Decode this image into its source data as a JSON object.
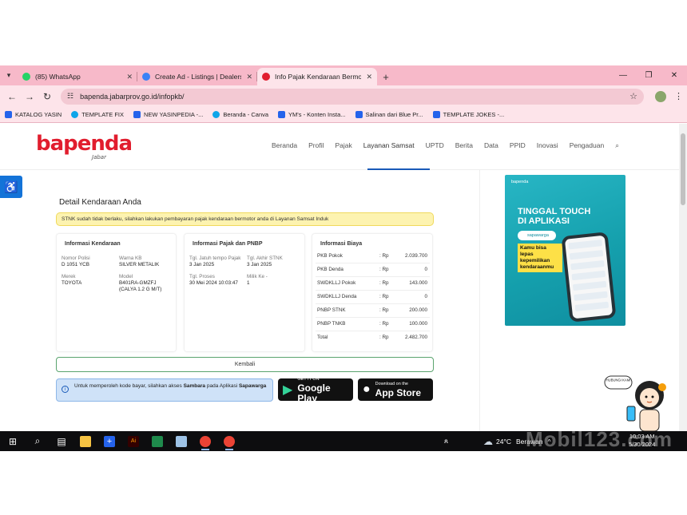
{
  "browser": {
    "tabs": [
      {
        "label": "(85) WhatsApp",
        "icon": "whatsapp-icon",
        "color": "#25d366"
      },
      {
        "label": "Create Ad - Listings | Dealership",
        "icon": "globe-icon",
        "color": "#3b82f6"
      },
      {
        "label": "Info Pajak Kendaraan Bermotor",
        "icon": "bapenda-icon",
        "color": "#e11d2e"
      }
    ],
    "url": "bapenda.jabarprov.go.id/infopkb/",
    "bookmarks": [
      {
        "label": "KATALOG YASIN",
        "color": "#2563eb"
      },
      {
        "label": "TEMPLATE FIX",
        "color": "#0ea5e9"
      },
      {
        "label": "NEW YASINPEDIA -...",
        "color": "#2563eb"
      },
      {
        "label": "Beranda - Canva",
        "color": "#0ea5e9"
      },
      {
        "label": "YM's - Konten Insta...",
        "color": "#2563eb"
      },
      {
        "label": "Salinan dari Blue Pr...",
        "color": "#2563eb"
      },
      {
        "label": "TEMPLATE JOKES -...",
        "color": "#2563eb"
      }
    ]
  },
  "site": {
    "logo": "bapenda",
    "logo_sub": "Jabar",
    "nav": [
      "Beranda",
      "Profil",
      "Pajak",
      "Layanan Samsat",
      "UPTD",
      "Berita",
      "Data",
      "PPID",
      "Inovasi",
      "Pengaduan"
    ],
    "active_nav": "Layanan Samsat"
  },
  "main": {
    "title": "Detail Kendaraan Anda",
    "alert": "STNK sudah tidak berlaku, silahkan lakukan pembayaran pajak kendaraan bermotor anda di Layanan Samsat Induk",
    "vehicle": {
      "heading": "Informasi Kendaraan",
      "nomor_polisi_label": "Nomor Polisi",
      "nomor_polisi": "D 1051 YCB",
      "warna_label": "Warna KB",
      "warna": "SILVER METALIK",
      "merek_label": "Merek",
      "merek": "TOYOTA",
      "model_label": "Model",
      "model_line1": "B401RA-GMZFJ",
      "model_line2": "(CALYA 1.2 G M/T)"
    },
    "tax": {
      "heading": "Informasi Pajak dan PNBP",
      "jatuh_tempo_label": "Tgl. Jatuh tempo Pajak",
      "jatuh_tempo": "3 Jan 2025",
      "akhir_stnk_label": "Tgl. Akhir STNK",
      "akhir_stnk": "3 Jan 2025",
      "proses_label": "Tgl. Proses",
      "proses": "30 Mei 2024 10:03:47",
      "milik_label": "Milik Ke -",
      "milik": "1"
    },
    "fees": {
      "heading": "Informasi Biaya",
      "currency": ": Rp",
      "rows": [
        {
          "label": "PKB Pokok",
          "value": "2.039.700"
        },
        {
          "label": "PKB Denda",
          "value": "0"
        },
        {
          "label": "SWDKLLJ Pokok",
          "value": "143.000"
        },
        {
          "label": "SWDKLLJ Denda",
          "value": "0"
        },
        {
          "label": "PNBP STNK",
          "value": "200.000"
        },
        {
          "label": "PNBP TNKB",
          "value": "100.000"
        },
        {
          "label": "Total",
          "value": "2.482.700"
        }
      ]
    },
    "back_button": "Kembali",
    "info_pre": "Untuk memperoleh kode bayar, silahkan akses ",
    "info_bold1": "Sambara",
    "info_mid": " pada Aplikasi ",
    "info_bold2": "Sapawarga",
    "google_play_small": "GET IT ON",
    "google_play": "Google Play",
    "app_store_small": "Download on the",
    "app_store": "App Store"
  },
  "banner": {
    "brand": "bapenda",
    "title_line1": "TINGGAL TOUCH",
    "title_line2": "DI APLIKASI",
    "pill": "sapawarga",
    "tag": "Kamu bisa lepas kepemilikan kendaraanmu"
  },
  "mascot": {
    "bubble": "HUBUNGI KAMI"
  },
  "taskbar": {
    "weather": "24°C",
    "weather_desc": "Berawan",
    "time": "10:03 AM",
    "date": "5/30/2024"
  },
  "watermark": "Mobil123.com"
}
